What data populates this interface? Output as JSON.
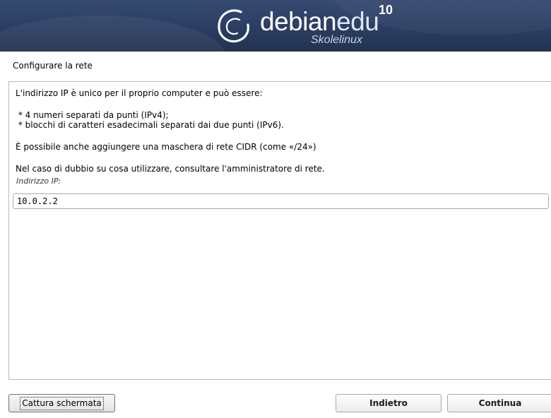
{
  "header": {
    "logo_word_1": "debian",
    "logo_word_2": "edu",
    "logo_version": "10",
    "logo_subtitle": "Skolelinux"
  },
  "page": {
    "title": "Configurare la rete"
  },
  "content": {
    "instruction_1": "L'indirizzo IP è unico per il proprio computer e può essere:",
    "bullet_1": " * 4 numeri separati da punti (IPv4);",
    "bullet_2": " * blocchi di caratteri esadecimali separati dai due punti (IPv6).",
    "instruction_2": "È possibile anche aggiungere una maschera di rete CIDR (come «/24»)",
    "instruction_3": "Nel caso di dubbio su cosa utilizzare, consultare l'amministratore di rete.",
    "ip_label": "Indirizzo IP:",
    "ip_value": "10.0.2.2"
  },
  "buttons": {
    "screenshot": "Cattura schermata",
    "back": "Indietro",
    "continue": "Continua"
  },
  "colors": {
    "banner": "#2b3d62",
    "frame_border": "#b9b9b9"
  },
  "icons": {
    "logo": "debian-swirl-icon"
  }
}
